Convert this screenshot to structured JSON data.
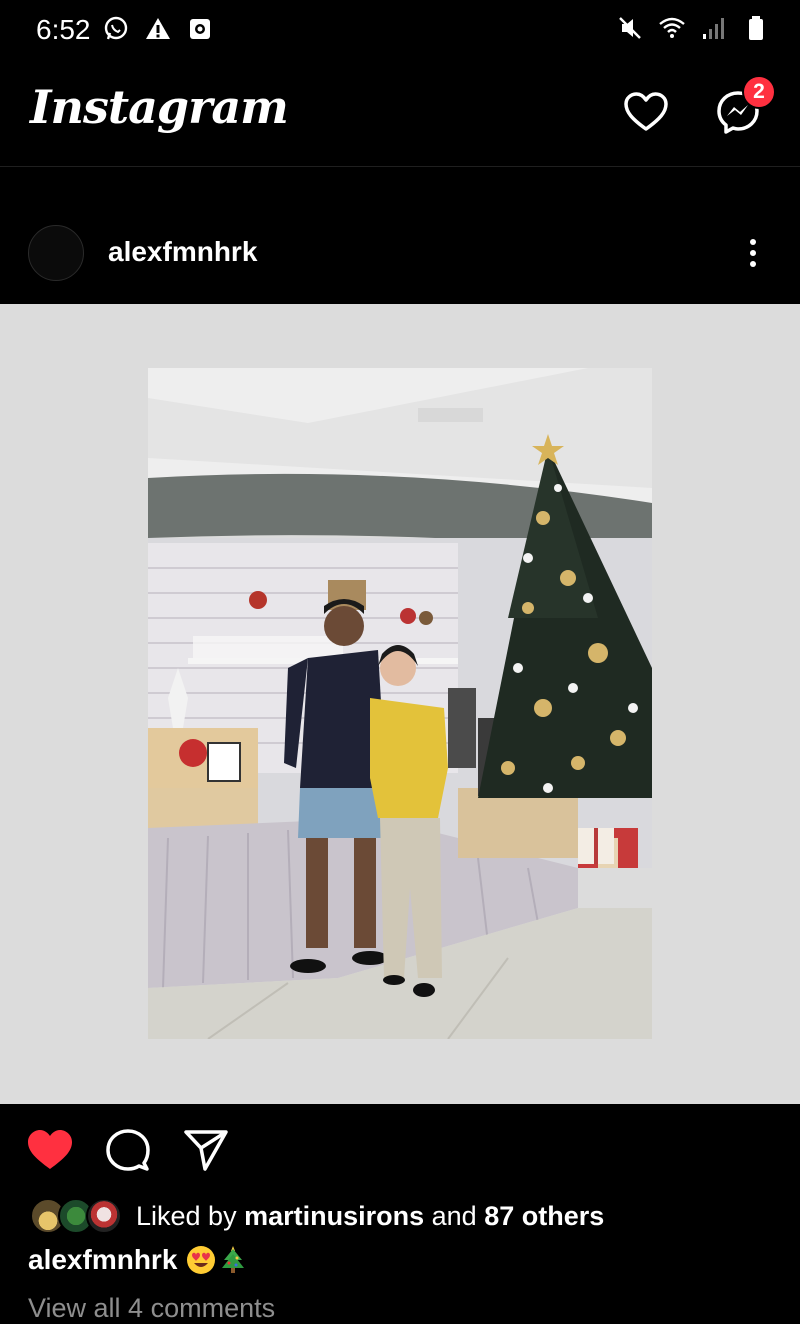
{
  "status_bar": {
    "time": "6:52",
    "left_icons": [
      "whatsapp-icon",
      "warning-icon",
      "screen-record-icon"
    ],
    "right_icons": [
      "mute-icon",
      "wifi-icon",
      "signal-icon",
      "battery-icon"
    ]
  },
  "header": {
    "logo": "Instagram",
    "messenger_badge": "2"
  },
  "post": {
    "username": "alexfmnhrk",
    "image_description_icon": "christmas-photo"
  },
  "likes": {
    "prefix": "Liked by ",
    "liker": "martinusirons",
    "middle": " and ",
    "others": "87 others"
  },
  "caption": {
    "user": "alexfmnhrk",
    "emojis": [
      "heart-eyes-emoji",
      "christmas-tree-emoji"
    ]
  },
  "comments": {
    "view_all": "View all 4 comments"
  },
  "colors": {
    "like_red": "#ff3040",
    "badge_red": "#ff3040",
    "muted_text": "#8e8e8e",
    "media_bg": "#dcdcdc"
  }
}
